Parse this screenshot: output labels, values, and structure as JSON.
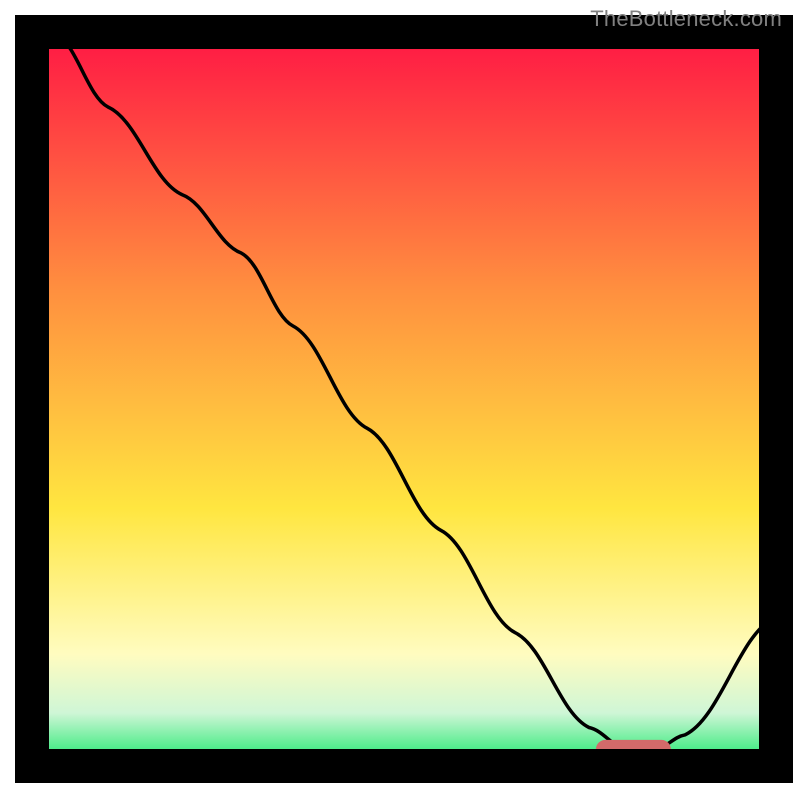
{
  "watermark": "TheBottleneck.com",
  "colors": {
    "gradient_top": "#ff1744",
    "gradient_mid_orange": "#ff8f3f",
    "gradient_yellow": "#ffe640",
    "gradient_pale_yellow": "#fffcc0",
    "gradient_mint": "#cff6d6",
    "gradient_green": "#18e86b",
    "curve_stroke": "#000000",
    "marker_fill": "#d36a6a",
    "marker_stroke": "#d36a6a",
    "frame": "#000000"
  },
  "chart_data": {
    "type": "line",
    "title": "",
    "xlabel": "",
    "ylabel": "",
    "xlim": [
      0,
      100
    ],
    "ylim": [
      0,
      100
    ],
    "series": [
      {
        "name": "bottleneck-curve",
        "x": [
          3,
          10,
          20,
          28,
          35,
          45,
          55,
          65,
          75,
          80,
          84,
          88,
          100
        ],
        "y": [
          100,
          90,
          78,
          70,
          60,
          46,
          32,
          18,
          5,
          2,
          2,
          4,
          20
        ]
      }
    ],
    "marker": {
      "name": "optimal-range",
      "x_start": 76,
      "x_end": 86,
      "y": 2
    }
  }
}
